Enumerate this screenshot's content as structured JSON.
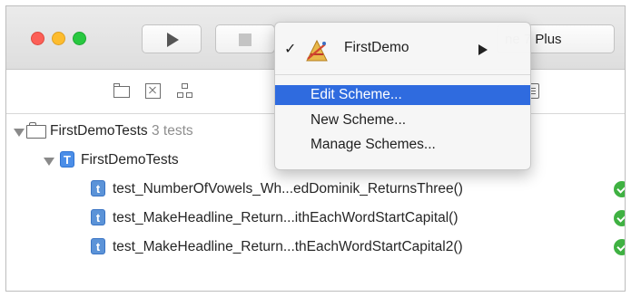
{
  "toolbar": {
    "device_label": "ne 7 Plus"
  },
  "navigator": {
    "icons": [
      "folder-icon",
      "source-control-icon",
      "hierarchy-icon",
      "report-icon"
    ]
  },
  "tests": {
    "group": {
      "label": "FirstDemoTests",
      "count": "3 tests"
    },
    "bundle": {
      "badge": "T",
      "label": "FirstDemoTests"
    },
    "methods": [
      {
        "badge": "t",
        "label": "test_NumberOfVowels_Wh...edDominik_ReturnsThree()",
        "status": "passed"
      },
      {
        "badge": "t",
        "label": "test_MakeHeadline_Return...ithEachWordStartCapital()",
        "status": "passed"
      },
      {
        "badge": "t",
        "label": "test_MakeHeadline_Return...thEachWordStartCapital2()",
        "status": "passed"
      }
    ]
  },
  "scheme_menu": {
    "current_scheme": "FirstDemo",
    "check_mark": "✓",
    "items": [
      {
        "label": "Edit Scheme...",
        "highlighted": true
      },
      {
        "label": "New Scheme...",
        "highlighted": false
      },
      {
        "label": "Manage Schemes...",
        "highlighted": false
      }
    ]
  },
  "colors": {
    "highlight": "#2f6bdf",
    "pass": "#3fb142",
    "badge": "#4b8ee8"
  }
}
